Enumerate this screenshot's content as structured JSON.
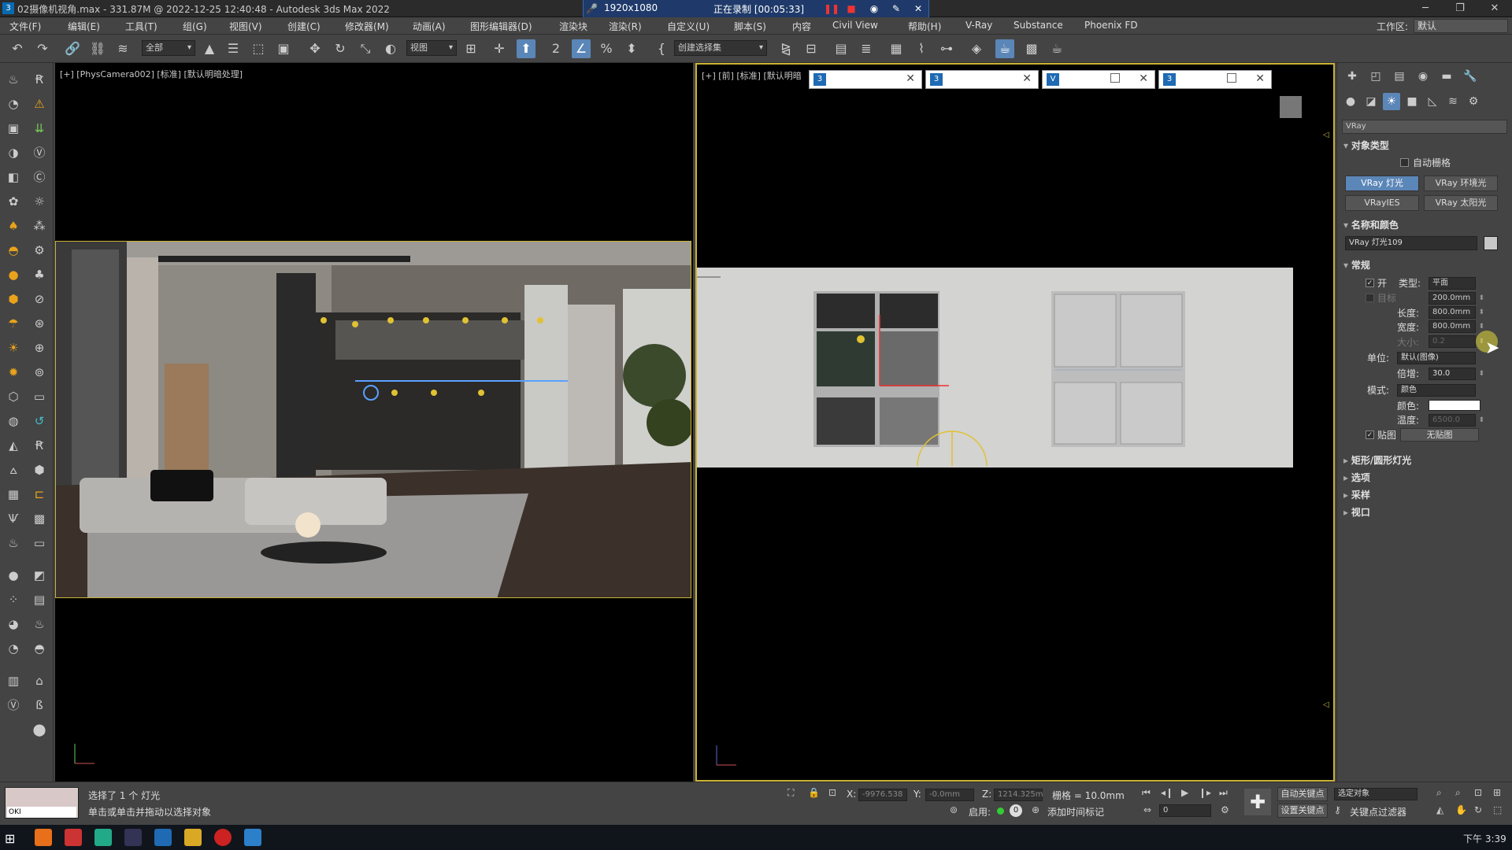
{
  "titlebar": {
    "app_icon": "3",
    "title": "02摄像机视角.max - 331.87M @ 2022-12-25 12:40:48 - Autodesk 3ds Max 2022",
    "recorder": {
      "resolution": "1920x1080",
      "status": "正在录制 [00:05:33]",
      "icons": [
        "pause-icon",
        "stop-icon",
        "camera-icon",
        "pen-icon",
        "close-icon"
      ]
    },
    "window_buttons": [
      "minimize-icon",
      "restore-icon",
      "close-icon"
    ]
  },
  "menubar": {
    "items": [
      "文件(F)",
      "编辑(E)",
      "工具(T)",
      "组(G)",
      "视图(V)",
      "创建(C)",
      "修改器(M)",
      "动画(A)",
      "图形编辑器(D)",
      "渲染块",
      "渲染(R)",
      "自定义(U)",
      "脚本(S)",
      "内容",
      "Civil View",
      "帮助(H)",
      "V-Ray",
      "Substance",
      "Phoenix FD"
    ],
    "workspace_label": "工作区:",
    "workspace_value": "默认"
  },
  "toolbar": {
    "filter_select": "全部",
    "view_select": "视图",
    "selection_set": "创建选择集"
  },
  "viewports": {
    "left_label": "[+] [PhysCamera002] [标准] [默认明暗处理]",
    "right_label": "[+] [前] [标准] [默认明暗",
    "tabs": [
      "",
      "",
      "",
      ""
    ]
  },
  "panel": {
    "renderer_select": "VRay",
    "sections": {
      "object_type": "对象类型",
      "name_color": "名称和颜色",
      "general": "常规",
      "rect_disc": "矩形/圆形灯光",
      "options": "选项",
      "sampling": "采样",
      "viewport": "视口"
    },
    "autogrid": "自动栅格",
    "buttons": [
      "VRay 灯光",
      "VRay 环境光",
      "VRayIES",
      "VRay 太阳光"
    ],
    "object_name": "VRay 灯光109",
    "on_label": "开",
    "type_label": "类型:",
    "type_value": "平面",
    "target_label": "目标",
    "target_value": "200.0mm",
    "length_label": "长度:",
    "length_value": "800.0mm",
    "width_label": "宽度:",
    "width_value": "800.0mm",
    "size_label": "大小:",
    "size_value": "0.2",
    "units_label": "单位:",
    "units_value": "默认(图像)",
    "multiplier_label": "倍增:",
    "multiplier_value": "30.0",
    "mode_label": "模式:",
    "mode_value": "颜色",
    "color_label": "颜色:",
    "color_swatch": "#ffffff",
    "temp_label": "温度:",
    "temp_value": "6500.0",
    "texture_label": "贴图",
    "texture_value": "无贴图"
  },
  "status": {
    "selected": "选择了 1 个 灯光",
    "hint": "单击或单击并拖动以选择对象",
    "mini_text": "OKI",
    "x_label": "X:",
    "x_value": "-9976.538",
    "y_label": "Y:",
    "y_value": "-0.0mm",
    "z_label": "Z:",
    "z_value": "1214.325m",
    "grid": "栅格 = 10.0mm",
    "enable_label": "启用:",
    "enable_value": "0",
    "add_time_tag": "添加时间标记",
    "auto_key": "自动关键点",
    "set_key": "设置关键点",
    "selected_object": "选定对象",
    "key_filter": "关键点过滤器",
    "frame": "0",
    "time": "下午 3:39"
  },
  "colors": {
    "accent": "#5b86b8",
    "viewport_border": "#c9b234",
    "ui_bg": "#444444"
  }
}
